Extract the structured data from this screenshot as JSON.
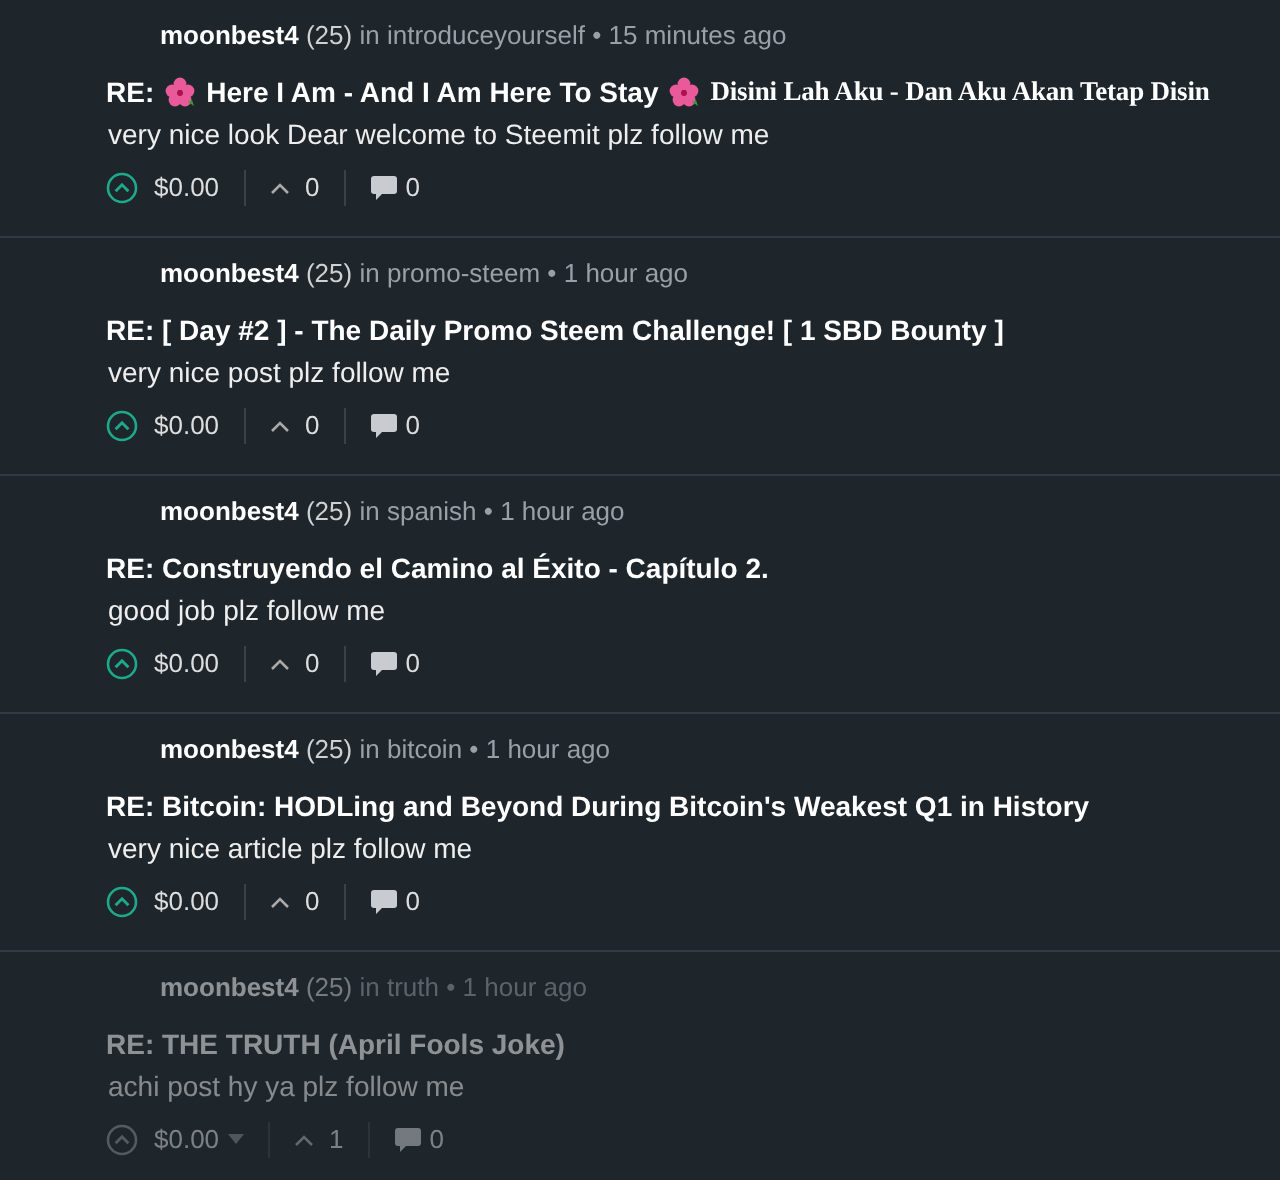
{
  "comments": [
    {
      "author": "moonbest4",
      "reputation": "(25)",
      "community_prefix": "in",
      "community": "introduceyourself",
      "separator": "•",
      "time": "15 minutes ago",
      "title": [
        {
          "kind": "text",
          "text": "RE:"
        },
        {
          "kind": "flower"
        },
        {
          "kind": "text",
          "text": "Here I Am - And I Am Here To Stay"
        },
        {
          "kind": "flower"
        },
        {
          "kind": "serif",
          "text": "Disini Lah Aku - Dan Aku Akan Tetap Disin"
        }
      ],
      "body": "very nice look Dear welcome to Steemit plz follow me",
      "payout": "$0.00",
      "votes": "0",
      "replies": "0",
      "dimmed": false
    },
    {
      "author": "moonbest4",
      "reputation": "(25)",
      "community_prefix": "in",
      "community": "promo-steem",
      "separator": "•",
      "time": "1 hour ago",
      "title": [
        {
          "kind": "text",
          "text": "RE: [ Day #2 ] - The Daily Promo Steem Challenge! [ 1 SBD Bounty ]"
        }
      ],
      "body": "very nice post plz follow me",
      "payout": "$0.00",
      "votes": "0",
      "replies": "0",
      "dimmed": false
    },
    {
      "author": "moonbest4",
      "reputation": "(25)",
      "community_prefix": "in",
      "community": "spanish",
      "separator": "•",
      "time": "1 hour ago",
      "title": [
        {
          "kind": "text",
          "text": "RE: Construyendo el Camino al Éxito - Capítulo 2."
        }
      ],
      "body": "good job plz follow me",
      "payout": "$0.00",
      "votes": "0",
      "replies": "0",
      "dimmed": false
    },
    {
      "author": "moonbest4",
      "reputation": "(25)",
      "community_prefix": "in",
      "community": "bitcoin",
      "separator": "•",
      "time": "1 hour ago",
      "title": [
        {
          "kind": "text",
          "text": "RE: Bitcoin: HODLing and Beyond During Bitcoin's Weakest Q1 in History"
        }
      ],
      "body": "very nice article plz follow me",
      "payout": "$0.00",
      "votes": "0",
      "replies": "0",
      "dimmed": false
    },
    {
      "author": "moonbest4",
      "reputation": "(25)",
      "community_prefix": "in",
      "community": "truth",
      "separator": "•",
      "time": "1 hour ago",
      "title": [
        {
          "kind": "text",
          "text": "RE: THE TRUTH (April Fools Joke)"
        }
      ],
      "body": "achi post hy ya plz follow me",
      "payout": "$0.00",
      "votes": "1",
      "replies": "0",
      "dimmed": true
    }
  ]
}
